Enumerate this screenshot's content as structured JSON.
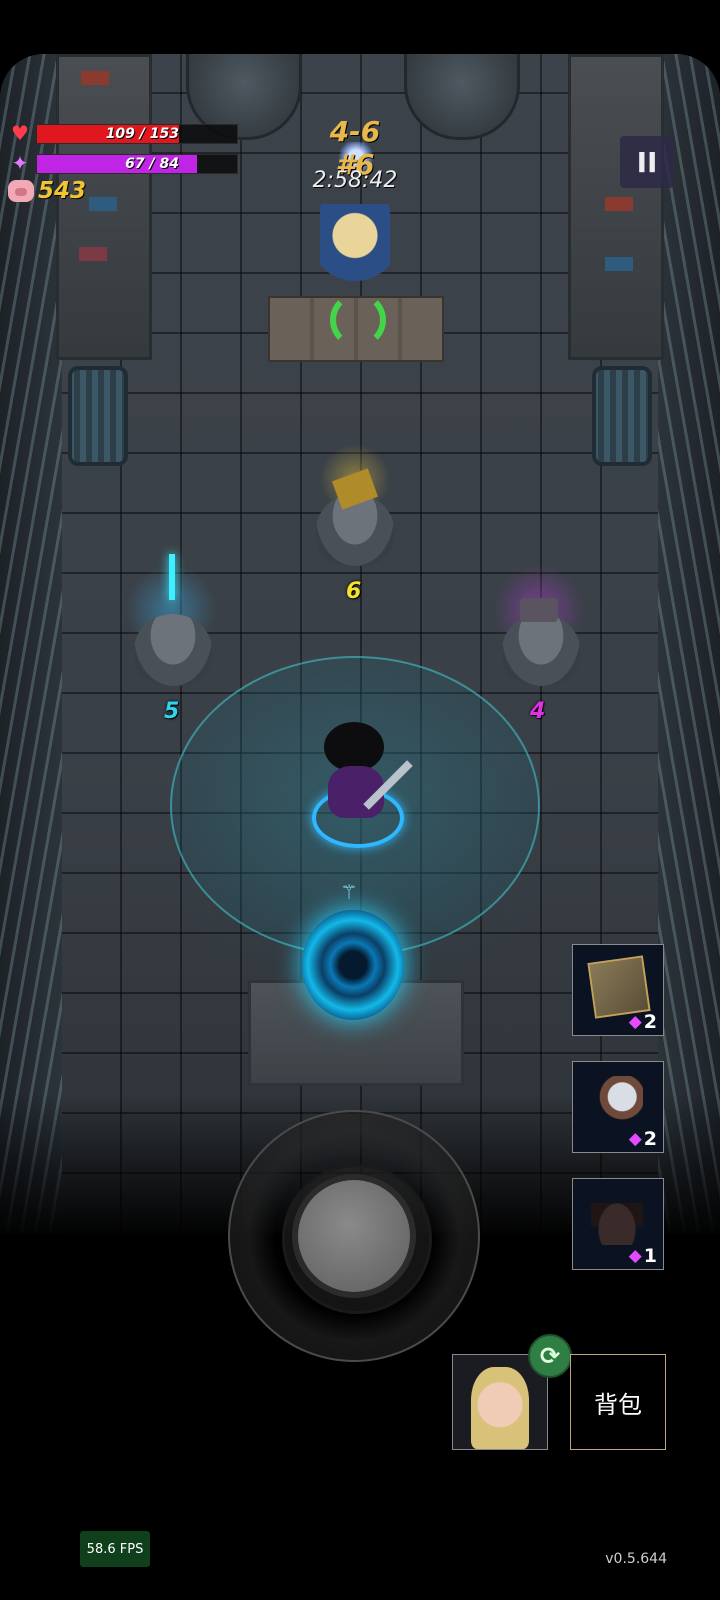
{
  "hud": {
    "health": {
      "text": "109 / 153",
      "current": 109,
      "max": 153,
      "color": "#e0171f",
      "icon": "heart-icon"
    },
    "mana": {
      "text": "67 / 84",
      "current": 67,
      "max": 84,
      "color": "#c025e6",
      "icon": "diamond-icon"
    },
    "gold": {
      "value": "543",
      "icon": "piggy-bank-icon"
    },
    "level": "4-6 #6",
    "timer": "2:58:42",
    "pause_label": "II"
  },
  "shop_prices": {
    "center": "6",
    "left": "5",
    "right": "4",
    "center_color": "#f5e22a",
    "left_color": "#2fd6f0",
    "right_color": "#e030e6"
  },
  "item_slots": [
    {
      "name": "rune-cube",
      "cost": "2",
      "icon": "rune-cube-icon"
    },
    {
      "name": "cart-turret",
      "cost": "2",
      "icon": "cart-turret-icon"
    },
    {
      "name": "top-hat",
      "cost": "1",
      "icon": "top-hat-icon"
    }
  ],
  "bottom": {
    "bag_label": "背包",
    "fps": "58.6 FPS",
    "version": "v0.5.644"
  },
  "colors": {
    "accent_gold": "#f0c531",
    "portal_cyan": "#2ad4ff",
    "swap_green": "#2f7f45"
  }
}
